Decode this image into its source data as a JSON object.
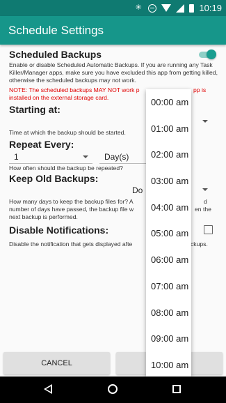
{
  "status_bar": {
    "time": "10:19",
    "icons": [
      "bluetooth-icon",
      "do-not-disturb-icon",
      "wifi-icon",
      "signal-icon",
      "battery-icon"
    ]
  },
  "app_bar": {
    "title": "Schedule Settings"
  },
  "scheduled_backups": {
    "title": "Scheduled Backups",
    "enabled": true,
    "description": "Enable or disable Scheduled Automatic Backups. If you are running any Task Killer/Manager apps, make sure you have excluded this app from getting killed, otherwise the scheduled backups may not work.",
    "note_visible": "NOTE: The scheduled backups MAY NOT work p",
    "note_tail": "pp is",
    "note_line2": "installed on the external storage card."
  },
  "starting_at": {
    "title": "Starting at:",
    "description": "Time at which the backup should be started."
  },
  "repeat_every": {
    "title": "Repeat Every:",
    "value": "1",
    "unit": "Day(s)",
    "description": "How often should the backup be repeated?"
  },
  "keep_old_backups": {
    "title": "Keep Old Backups:",
    "value_visible": "Do",
    "desc_line1_left": "How many days to keep the backup files for? A",
    "desc_line1_right": "d",
    "desc_line2_left": "number of days have passed, the backup file w",
    "desc_line2_right": "en the",
    "desc_line3": "next backup is performed."
  },
  "disable_notifications": {
    "title": "Disable Notifications:",
    "checked": false,
    "desc_left": "Disable the notification that gets displayed afte",
    "desc_right": "ckups."
  },
  "buttons": {
    "cancel": "CANCEL"
  },
  "time_dropdown": {
    "options": [
      "00:00 am",
      "01:00 am",
      "02:00 am",
      "03:00 am",
      "04:00 am",
      "05:00 am",
      "06:00 am",
      "07:00 am",
      "08:00 am",
      "09:00 am",
      "10:00 am"
    ]
  },
  "colors": {
    "status_bar": "#0f7a71",
    "app_bar": "#16968a",
    "accent": "#1a9e90",
    "note_red": "#e00000"
  }
}
